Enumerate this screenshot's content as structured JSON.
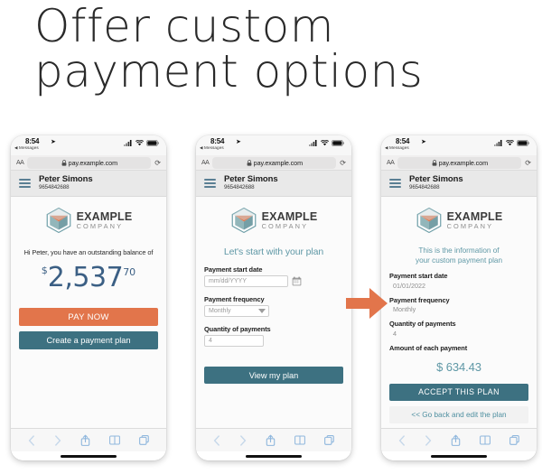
{
  "headline": {
    "line1": "Offer custom",
    "line2": "payment options"
  },
  "status_bar": {
    "time": "8:54",
    "location_icon": "location-arrow-icon",
    "back_app": "Messages",
    "signal_icon": "cellular-signal-icon",
    "wifi_icon": "wifi-icon",
    "battery_icon": "battery-icon"
  },
  "browser": {
    "text_size_label": "AA",
    "lock_icon": "lock-icon",
    "url": "pay.example.com",
    "reload_icon": "reload-icon",
    "toolbar": {
      "back_icon": "chevron-left-icon",
      "forward_icon": "chevron-right-icon",
      "share_icon": "share-icon",
      "bookmarks_icon": "book-icon",
      "tabs_icon": "tabs-icon"
    }
  },
  "app_header": {
    "menu_icon": "hamburger-menu-icon",
    "customer_name": "Peter Simons",
    "account_number": "9654842688"
  },
  "logo": {
    "mark_icon": "example-company-cube-logo",
    "name": "EXAMPLE",
    "tagline": "COMPANY"
  },
  "screen1": {
    "balance_message": "Hi Peter, you have an outstanding balance of",
    "currency_symbol": "$",
    "balance_whole": "2,537",
    "balance_cents": "70",
    "pay_now_label": "PAY NOW",
    "create_plan_label": "Create a payment plan"
  },
  "screen2": {
    "heading": "Let's start with your plan",
    "start_date_label": "Payment start date",
    "start_date_placeholder": "mm/dd/YYYY",
    "calendar_icon": "calendar-icon",
    "frequency_label": "Payment frequency",
    "frequency_value": "Monthly",
    "frequency_caret": "chevron-down-icon",
    "quantity_label": "Quantity of payments",
    "quantity_value": "4",
    "view_plan_label": "View my plan"
  },
  "screen3": {
    "heading_line1": "This is the information of",
    "heading_line2": "your custom payment plan",
    "start_date_label": "Payment start date",
    "start_date_value": "01/01/2022",
    "frequency_label": "Payment frequency",
    "frequency_value": "Monthly",
    "quantity_label": "Quantity of payments",
    "quantity_value": "4",
    "amount_label": "Amount of each payment",
    "amount_value": "$ 634.43",
    "accept_label": "ACCEPT THIS PLAN",
    "goback_label": "<< Go back and edit the plan"
  },
  "flow_arrow": {
    "icon": "right-arrow-icon",
    "color": "#e2754b"
  },
  "colors": {
    "teal": "#3d7181",
    "teal_light": "#5f98a6",
    "orange": "#e2754b",
    "balance_blue": "#3b5f84",
    "header_gray": "#e9e9e9"
  }
}
